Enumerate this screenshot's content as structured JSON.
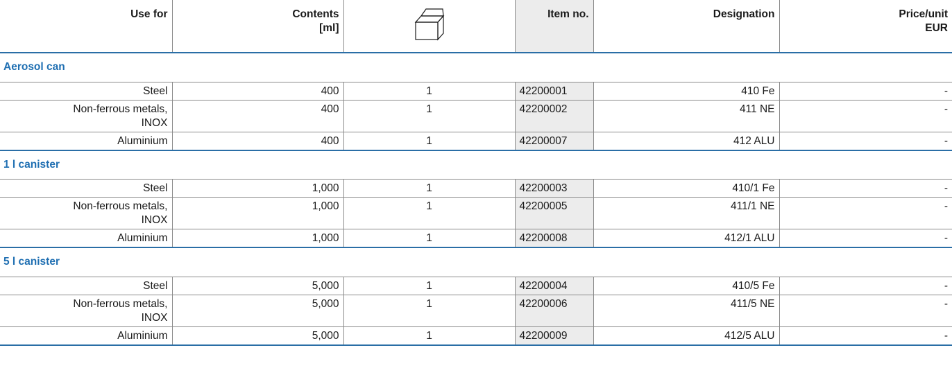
{
  "headers": {
    "use_for": "Use for",
    "contents_line1": "Contents",
    "contents_line2": "[ml]",
    "package_icon": "box-open-icon",
    "item_no": "Item no.",
    "designation": "Designation",
    "price_line1": "Price/unit",
    "price_line2": "EUR"
  },
  "groups": [
    {
      "title": "Aerosol can",
      "rows": [
        {
          "use_for_line1": "Steel",
          "use_for_line2": "",
          "contents": "400",
          "qty": "1",
          "item_no": "42200001",
          "designation": "410 Fe",
          "price": "-"
        },
        {
          "use_for_line1": "Non-ferrous metals,",
          "use_for_line2": "INOX",
          "contents": "400",
          "qty": "1",
          "item_no": "42200002",
          "designation": "411 NE",
          "price": "-"
        },
        {
          "use_for_line1": "Aluminium",
          "use_for_line2": "",
          "contents": "400",
          "qty": "1",
          "item_no": "42200007",
          "designation": "412 ALU",
          "price": "-"
        }
      ]
    },
    {
      "title": "1 l canister",
      "rows": [
        {
          "use_for_line1": "Steel",
          "use_for_line2": "",
          "contents": "1,000",
          "qty": "1",
          "item_no": "42200003",
          "designation": "410/1 Fe",
          "price": "-"
        },
        {
          "use_for_line1": "Non-ferrous metals,",
          "use_for_line2": "INOX",
          "contents": "1,000",
          "qty": "1",
          "item_no": "42200005",
          "designation": "411/1 NE",
          "price": "-"
        },
        {
          "use_for_line1": "Aluminium",
          "use_for_line2": "",
          "contents": "1,000",
          "qty": "1",
          "item_no": "42200008",
          "designation": "412/1 ALU",
          "price": "-"
        }
      ]
    },
    {
      "title": "5 l canister",
      "rows": [
        {
          "use_for_line1": "Steel",
          "use_for_line2": "",
          "contents": "5,000",
          "qty": "1",
          "item_no": "42200004",
          "designation": "410/5 Fe",
          "price": "-"
        },
        {
          "use_for_line1": "Non-ferrous metals,",
          "use_for_line2": "INOX",
          "contents": "5,000",
          "qty": "1",
          "item_no": "42200006",
          "designation": "411/5 NE",
          "price": "-"
        },
        {
          "use_for_line1": "Aluminium",
          "use_for_line2": "",
          "contents": "5,000",
          "qty": "1",
          "item_no": "42200009",
          "designation": "412/5 ALU",
          "price": "-"
        }
      ]
    }
  ],
  "colors": {
    "accent": "#1f6fb2",
    "rule": "#2a6ea6",
    "item_shade": "#ececec"
  }
}
